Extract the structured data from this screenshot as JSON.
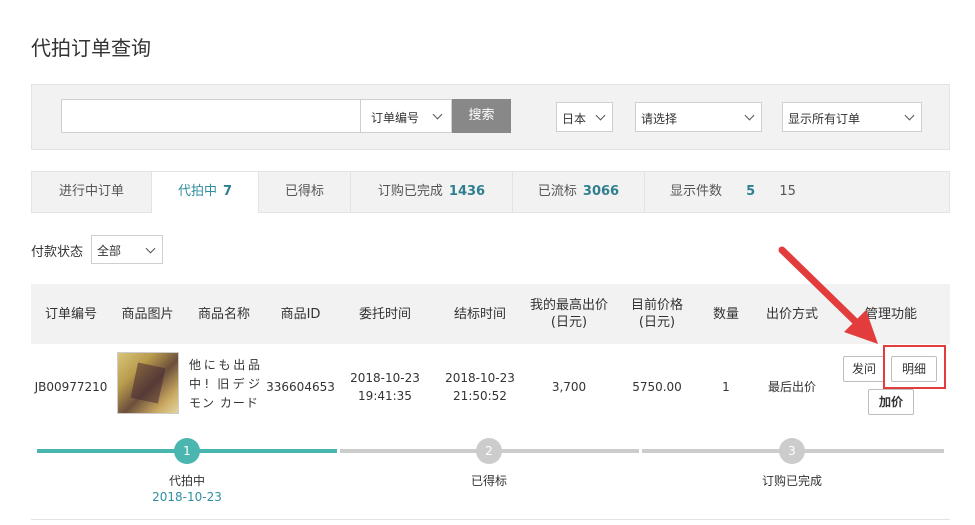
{
  "page": {
    "title": "代拍订单查询"
  },
  "search": {
    "input_value": "",
    "field_select": "订单编号",
    "button_label": "搜索",
    "country_select": "日本",
    "status_select": "请选择",
    "order_filter_select": "显示所有订单"
  },
  "tabs": [
    {
      "label": "进行中订单",
      "count": ""
    },
    {
      "label": "代拍中",
      "count": "7"
    },
    {
      "label": "已得标",
      "count": ""
    },
    {
      "label": "订购已完成",
      "count": "1436"
    },
    {
      "label": "已流标",
      "count": "3066"
    }
  ],
  "display_count": {
    "label": "显示件数",
    "option_a": "5",
    "option_b": "15"
  },
  "payment": {
    "label": "付款状态",
    "value": "全部"
  },
  "table": {
    "headers": {
      "order_no": "订单编号",
      "image": "商品图片",
      "name": "商品名称",
      "item_id": "商品ID",
      "commission_time": "委托时间",
      "end_time": "结标时间",
      "max_bid_l1": "我的最高出价",
      "max_bid_l2": "(日元)",
      "current_price_l1": "目前价格",
      "current_price_l2": "(日元)",
      "quantity": "数量",
      "bid_method": "出价方式",
      "manage": "管理功能"
    },
    "row": {
      "order_no": "JB00977210",
      "name": "他にも出品中! 旧デジモン カード",
      "item_id": "336604653",
      "commission_date": "2018-10-23",
      "commission_clock": "19:41:35",
      "end_date": "2018-10-23",
      "end_clock": "21:50:52",
      "max_bid": "3,700",
      "current_price": "5750.00",
      "quantity": "1",
      "bid_method": "最后出价",
      "btn_message": "发问",
      "btn_detail": "明细",
      "btn_raise": "加价"
    }
  },
  "progress": {
    "steps": [
      {
        "num": "1",
        "label": "代拍中",
        "date": "2018-10-23"
      },
      {
        "num": "2",
        "label": "已得标",
        "date": ""
      },
      {
        "num": "3",
        "label": "订购已完成",
        "date": ""
      }
    ]
  },
  "colors": {
    "accent": "#4bb5b0",
    "inactive": "#cccccc",
    "highlight": "#e23c3c",
    "tab_count": "#2f7f8f"
  }
}
